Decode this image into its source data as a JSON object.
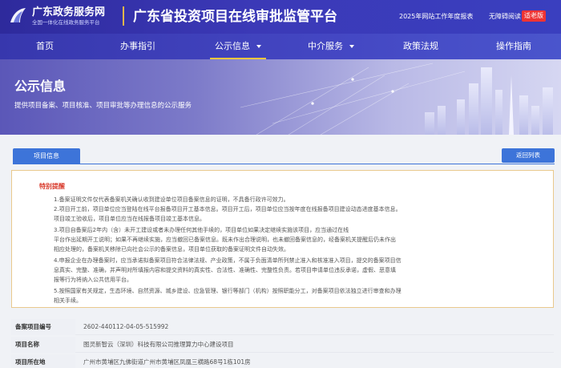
{
  "header": {
    "gov_name": "广东政务服务网",
    "gov_slogan": "全国一体化在线政务服务平台",
    "site_title": "广东省投资项目在线审批监管平台",
    "report_link": "2025年网站工作年度报表",
    "accessible_link": "无障碍阅读",
    "elder_badge": "适老版"
  },
  "nav": {
    "items": [
      {
        "label": "首页"
      },
      {
        "label": "办事指引"
      },
      {
        "label": "公示信息"
      },
      {
        "label": "中介服务"
      },
      {
        "label": "政策法规"
      },
      {
        "label": "操作指南"
      }
    ]
  },
  "banner": {
    "title": "公示信息",
    "subtitle": "提供项目备案、项目核准、项目审批等办理信息的公示服务"
  },
  "tabs": {
    "project_info": "项目信息",
    "back_label": "返回列表"
  },
  "notice": {
    "title": "特别提醒",
    "lines": [
      "1.备案证明文件仅代表备案机关确认收到建设单位项目备案信息的证明，不具备行政许可效力。",
      "2.项目开工前，项目单位应当登陆在线平台报备项目开工基本信息。项目开工后，项目单位应当按年度在线报备项目建设动态进度基本信息。",
      "  项目竣工验收后，项目单位应当在线报备项目竣工基本信息。",
      "3.项目自备案后2年内（含）未开工建设或者未办理任何其他手续的，项目单位如果决定继续实施该项目，应当通过在线",
      "  平台作出延期开工说明；如果不再继续实施，应当撤回已备案信息。既未作出合理说明，也未撤回备案信息的，经备案机关提醒后仍未作出",
      "  相应处理的，备案机关移除已向社会公示的备案信息，项目单位获取的备案证明文件自动失效。",
      "4.申报企业在办理备案时，应当承诺拟备案项目符合法律法规、产业政策，不属于负面清单所列禁止准入和核准准入项目，提交的备案项目信",
      "  息真实、完整、准确，并声明对所填报内容和提交资料的真实性、合法性、准确性、完整性负责。若项目申请单位违反承诺，虚假、恶意填",
      "  报等行为将纳入公共信用平台。",
      "5.按照国家有关规定，生态环境、自然资源、城乡建设、应急管理、银行等部门（机构）按照职能分工，对备案项目依法独立进行审查和办理",
      "  相关手续。"
    ]
  },
  "info_table": {
    "rows": [
      {
        "label": "备案项目编号",
        "value": "2602-440112-04-05-515992"
      },
      {
        "label": "项目名称",
        "value": "图灵新智云（深圳）科技有限公司推理算力中心建设项目"
      },
      {
        "label": "项目所在地",
        "value": "广州市黄埔区九佛街道广州市黄埔区凤凰三横路68号1栋101房"
      }
    ]
  },
  "colors": {
    "header_bg": "#2e2a9c",
    "nav_bg": "#3737ad",
    "accent_blue": "#3d74d9",
    "notice_title": "#d83a2b",
    "active_underline": "#f3c640",
    "elder_badge": "#e33333"
  }
}
